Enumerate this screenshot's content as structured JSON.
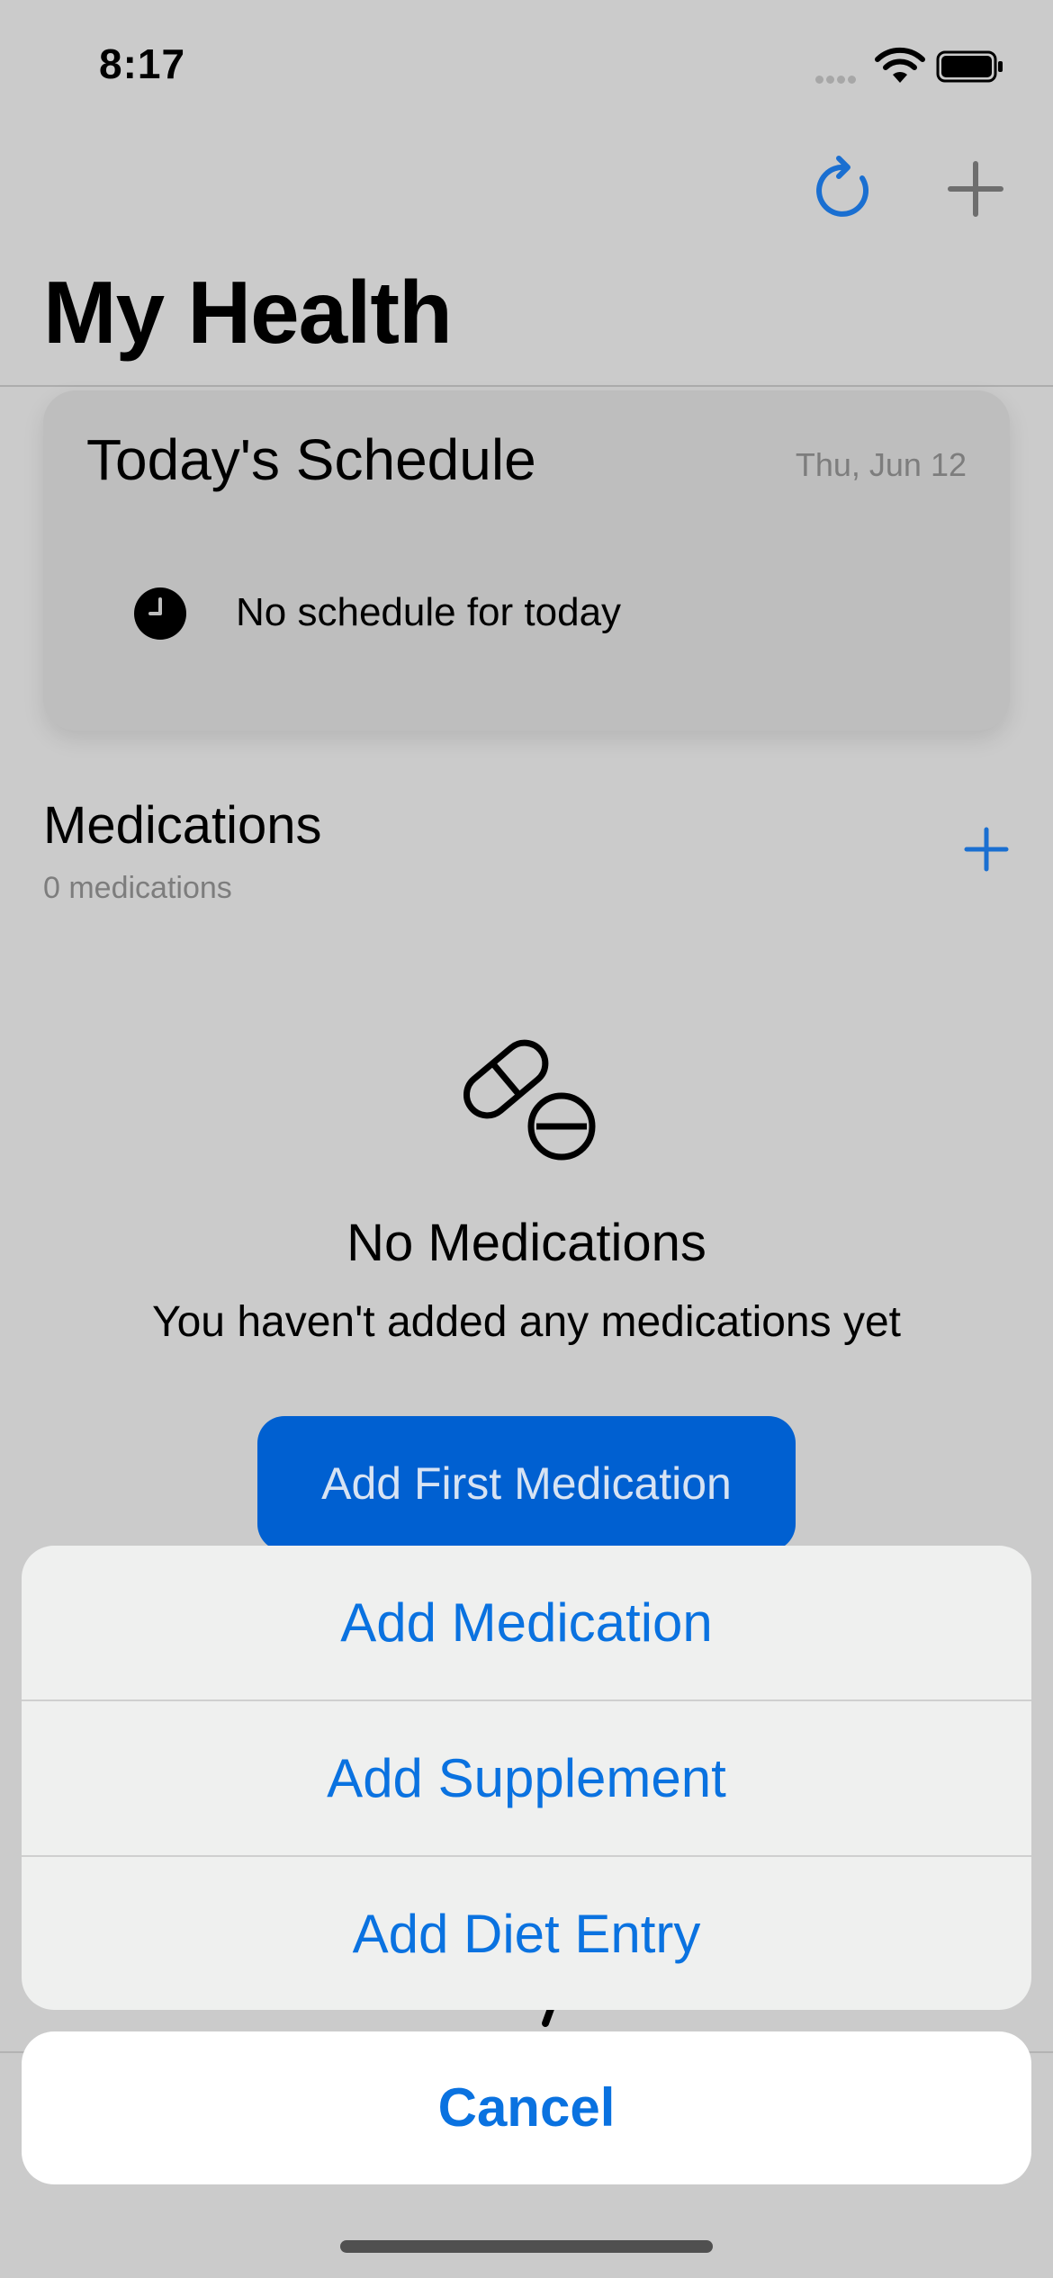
{
  "status_bar": {
    "time": "8:17"
  },
  "nav": {
    "title": "My Health",
    "refresh_icon": "refresh-icon",
    "add_icon": "plus-icon"
  },
  "schedule": {
    "title": "Today's Schedule",
    "date": "Thu, Jun 12",
    "empty_text": "No schedule for today",
    "icon": "clock-icon"
  },
  "medications": {
    "title": "Medications",
    "count": "0 medications",
    "empty_title": "No Medications",
    "empty_subtitle": "You haven't added any medications yet",
    "first_button": "Add First Medication"
  },
  "action_sheet": {
    "items": [
      {
        "label": "Add Medication"
      },
      {
        "label": "Add Supplement"
      },
      {
        "label": "Add Diet Entry"
      }
    ],
    "cancel": "Cancel"
  },
  "colors": {
    "accent": "#0A72E0",
    "button_fill": "#0060D1",
    "background": "#CBCBCB"
  }
}
